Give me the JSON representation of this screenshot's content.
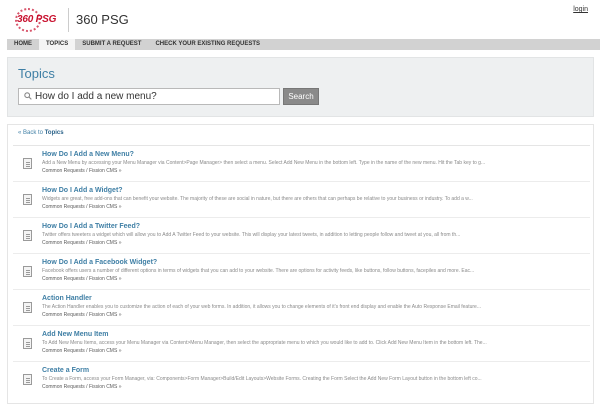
{
  "header": {
    "logo_text": "360 PSG",
    "brand": "360 PSG",
    "login": "login"
  },
  "nav": {
    "items": [
      "HOME",
      "TOPICS",
      "SUBMIT A REQUEST",
      "CHECK YOUR EXISTING REQUESTS"
    ],
    "active": "TOPICS"
  },
  "search": {
    "title": "Topics",
    "value": "How do I add a new menu?",
    "button": "Search"
  },
  "results": {
    "back_prefix": "« Back to ",
    "back_link": "Topics",
    "items": [
      {
        "title": "How Do I Add a New Menu?",
        "snippet": "Add a New Menu by accessing your Menu Manager via Content>Page Manager> then select a menu. Select Add New Menu in the bottom left. Type in the name of the new menu. Hit the Tab key to g...",
        "category": "Common Requests / Fission CMS »"
      },
      {
        "title": "How Do I Add a Widget?",
        "snippet": "Widgets are great, free add-ons that can benefit your website. The majority of these are social in nature, but there are others that can perhaps be relative to your business or industry. To add a w...",
        "category": "Common Requests / Fission CMS »"
      },
      {
        "title": "How Do I Add a Twitter Feed?",
        "snippet": "Twitter offers tweeters a widget which will allow you to Add A Twitter Feed to your website. This will display your latest tweets, in addition to letting people follow and tweet at you, all from th...",
        "category": "Common Requests / Fission CMS »"
      },
      {
        "title": "How Do I Add a Facebook Widget?",
        "snippet": "Facebook offers users a number of different options in terms of widgets that you can add to your website. There are options for activity feeds, like buttons, follow buttons, facepiles and more. Eac...",
        "category": "Common Requests / Fission CMS »"
      },
      {
        "title": "Action Handler",
        "snippet": "The Action Handler enables you to customize the action of each of your web forms. In addition, it allows you to change elements of it's front end display and enable the Auto Response Email feature...",
        "category": "Common Requests / Fission CMS »"
      },
      {
        "title": "Add New Menu Item",
        "snippet": "To Add New Menu Items, access your Menu Manager via Content>Menu Manager, then select the appropriate menu to which you would like to add to. Click Add New Menu Item in the bottom left. The...",
        "category": "Common Requests / Fission CMS »"
      },
      {
        "title": "Create a Form",
        "snippet": "To Create a Form, access your Form Manager, via: Components>Form Manager>Build/Edit Layouts>Website Forms. Creating the Form Select the Add New Form Layout button in the bottom left co...",
        "category": "Common Requests / Fission CMS »"
      }
    ]
  }
}
